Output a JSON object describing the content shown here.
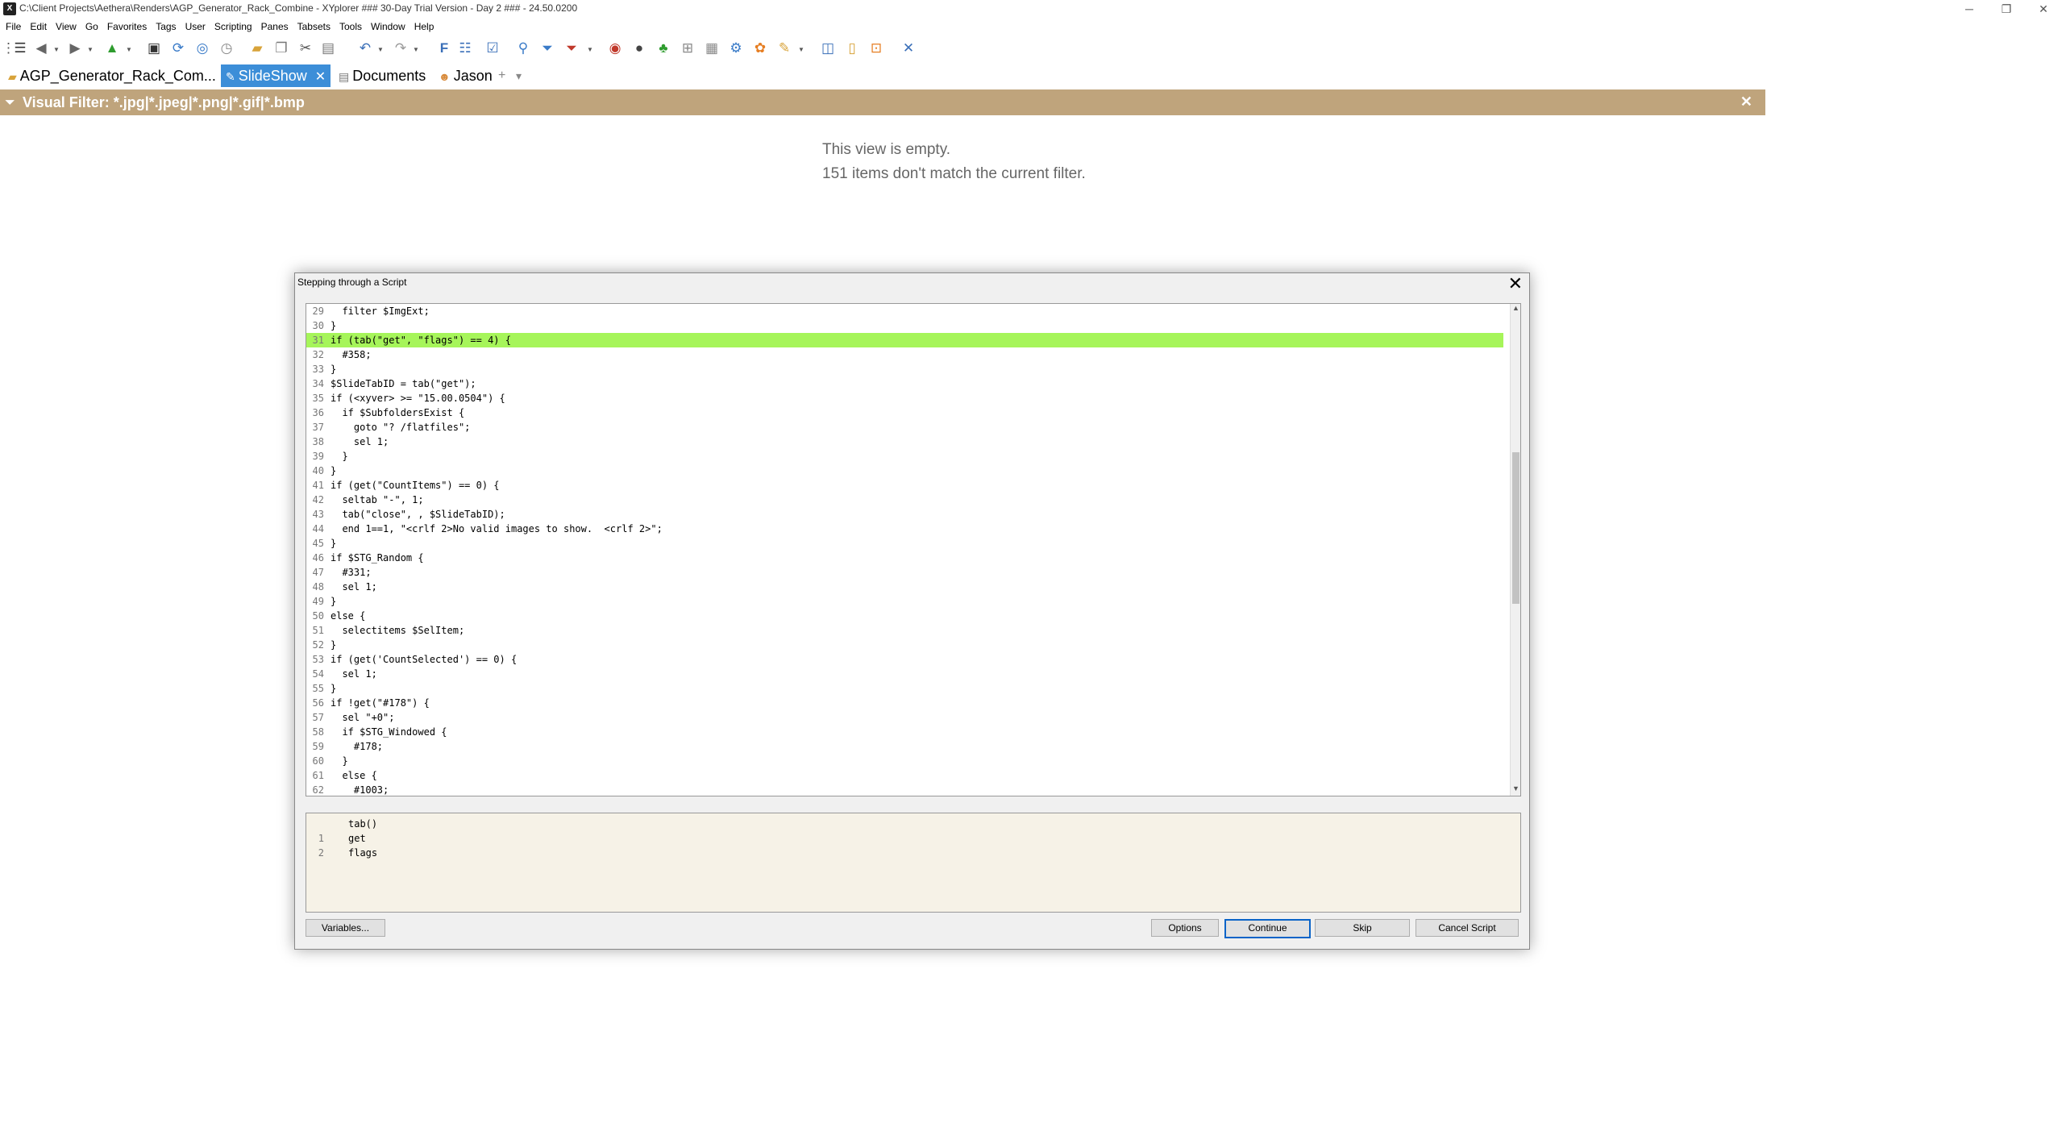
{
  "window": {
    "title": "C:\\Client Projects\\Aethera\\Renders\\AGP_Generator_Rack_Combine - XYplorer ### 30-Day Trial Version - Day 2 ### - 24.50.0200",
    "app_icon_glyph": "X"
  },
  "menu": [
    "File",
    "Edit",
    "View",
    "Go",
    "Favorites",
    "Tags",
    "User",
    "Scripting",
    "Panes",
    "Tabsets",
    "Tools",
    "Window",
    "Help"
  ],
  "tabs": [
    {
      "label": "AGP_Generator_Rack_Com...",
      "icon": "folder-icon"
    },
    {
      "label": "SlideShow",
      "icon": "brush-icon",
      "active": true
    },
    {
      "label": "Documents",
      "icon": "documents-icon"
    },
    {
      "label": "Jason",
      "icon": "user-icon"
    }
  ],
  "tab_controls": {
    "add": "+",
    "dropdown": "▾"
  },
  "filter": {
    "label": "Visual Filter:  *.jpg|*.jpeg|*.png|*.gif|*.bmp",
    "close": "✕"
  },
  "empty_view": {
    "line1": "This view is empty.",
    "line2": "151 items don't match the current filter."
  },
  "dialog": {
    "title": "Stepping through a Script",
    "close": "✕",
    "highlight_color": "#a6f55a",
    "code_lines": [
      {
        "n": "29",
        "t": "  filter $ImgExt;"
      },
      {
        "n": "30",
        "t": "}"
      },
      {
        "n": "31",
        "t": "if (tab(\"get\", \"flags\") == 4) {",
        "hl": true
      },
      {
        "n": "32",
        "t": "  #358;"
      },
      {
        "n": "33",
        "t": "}"
      },
      {
        "n": "34",
        "t": "$SlideTabID = tab(\"get\");"
      },
      {
        "n": "35",
        "t": "if (<xyver> >= \"15.00.0504\") {"
      },
      {
        "n": "36",
        "t": "  if $SubfoldersExist {"
      },
      {
        "n": "37",
        "t": "    goto \"? /flatfiles\";"
      },
      {
        "n": "38",
        "t": "    sel 1;"
      },
      {
        "n": "39",
        "t": "  }"
      },
      {
        "n": "40",
        "t": "}"
      },
      {
        "n": "41",
        "t": "if (get(\"CountItems\") == 0) {"
      },
      {
        "n": "42",
        "t": "  seltab \"-\", 1;"
      },
      {
        "n": "43",
        "t": "  tab(\"close\", , $SlideTabID);"
      },
      {
        "n": "44",
        "t": "  end 1==1, \"<crlf 2>No valid images to show.  <crlf 2>\";"
      },
      {
        "n": "45",
        "t": "}"
      },
      {
        "n": "46",
        "t": "if $STG_Random {"
      },
      {
        "n": "47",
        "t": "  #331;"
      },
      {
        "n": "48",
        "t": "  sel 1;"
      },
      {
        "n": "49",
        "t": "}"
      },
      {
        "n": "50",
        "t": "else {"
      },
      {
        "n": "51",
        "t": "  selectitems $SelItem;"
      },
      {
        "n": "52",
        "t": "}"
      },
      {
        "n": "53",
        "t": "if (get('CountSelected') == 0) {"
      },
      {
        "n": "54",
        "t": "  sel 1;"
      },
      {
        "n": "55",
        "t": "}"
      },
      {
        "n": "56",
        "t": "if !get(\"#178\") {"
      },
      {
        "n": "57",
        "t": "  sel \"+0\";"
      },
      {
        "n": "58",
        "t": "  if $STG_Windowed {"
      },
      {
        "n": "59",
        "t": "    #178;"
      },
      {
        "n": "60",
        "t": "  }"
      },
      {
        "n": "61",
        "t": "  else {"
      },
      {
        "n": "62",
        "t": "    #1003;"
      }
    ],
    "args": [
      {
        "n": "",
        "t": "tab()"
      },
      {
        "n": "1",
        "t": "get"
      },
      {
        "n": "2",
        "t": "flags"
      }
    ],
    "buttons": {
      "variables": "Variables...",
      "options": "Options",
      "continue": "Continue",
      "skip": "Skip",
      "cancel": "Cancel Script"
    }
  }
}
